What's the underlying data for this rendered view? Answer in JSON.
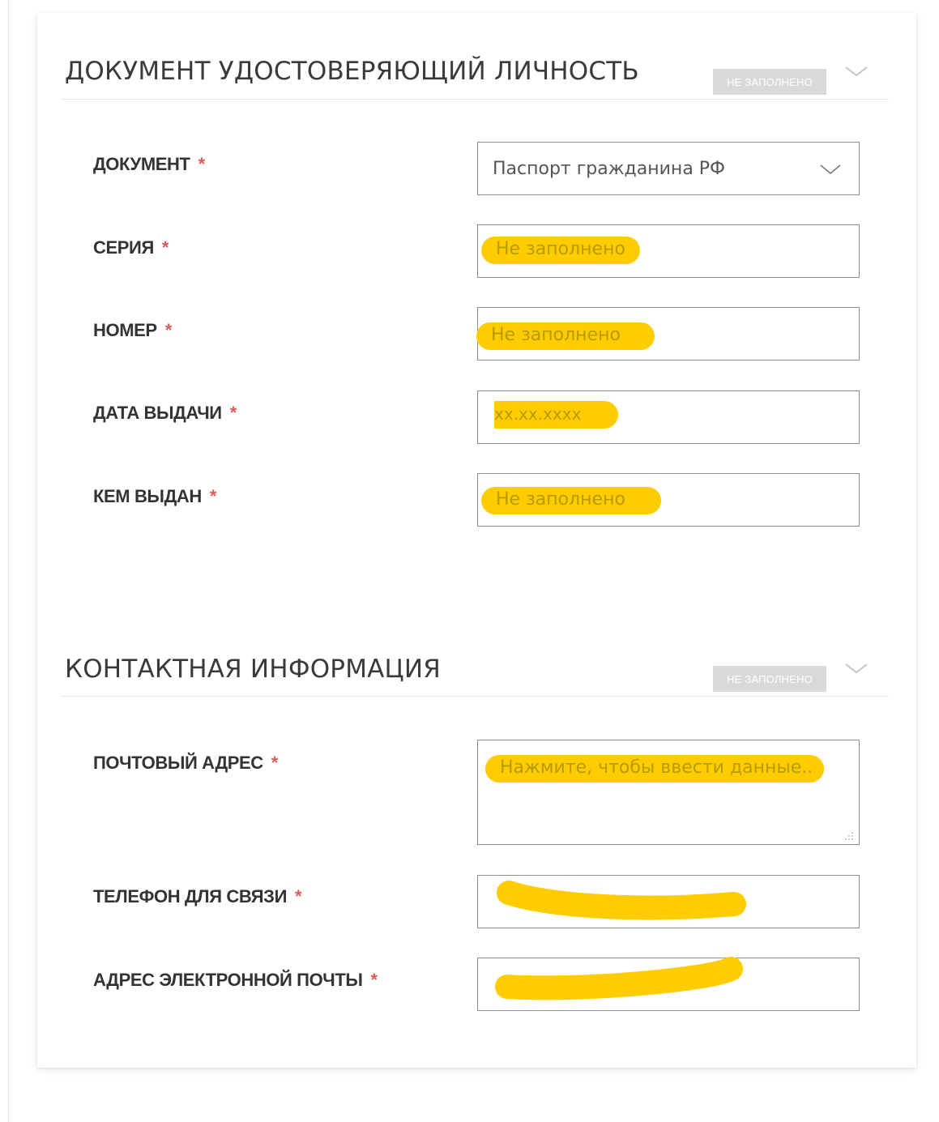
{
  "sections": [
    {
      "title": "ДОКУМЕНТ УДОСТОВЕРЯЮЩИЙ ЛИЧНОСТЬ",
      "status": "НЕ ЗАПОЛНЕНО",
      "fields": [
        {
          "label": "ДОКУМЕНТ",
          "required": "*",
          "value": "Паспорт гражданина РФ"
        },
        {
          "label": "СЕРИЯ",
          "required": "*",
          "placeholder": "Не заполнено"
        },
        {
          "label": "НОМЕР",
          "required": "*",
          "placeholder": "Не заполнено"
        },
        {
          "label": "ДАТА ВЫДАЧИ",
          "required": "*",
          "placeholder": "xx.xx.xxxx"
        },
        {
          "label": "КЕМ ВЫДАН",
          "required": "*",
          "placeholder": "Не заполнено"
        }
      ]
    },
    {
      "title": "КОНТАКТНАЯ ИНФОРМАЦИЯ",
      "status": "НЕ ЗАПОЛНЕНО",
      "fields": [
        {
          "label": "ПОЧТОВЫЙ АДРЕС",
          "required": "*",
          "placeholder": "Нажмите, чтобы ввести данные.."
        },
        {
          "label": "ТЕЛЕФОН ДЛЯ СВЯЗИ",
          "required": "*"
        },
        {
          "label": "АДРЕС ЭЛЕКТРОННОЙ ПОЧТЫ",
          "required": "*"
        }
      ]
    }
  ],
  "colors": {
    "highlight": "#ffcc00",
    "required_star": "#e05a5a",
    "badge_bg": "#d9d9d9"
  },
  "icons": {
    "section_toggle": "chevron-down-icon",
    "select_toggle": "chevron-down-icon",
    "textarea_resize": "resize-grip-icon"
  }
}
